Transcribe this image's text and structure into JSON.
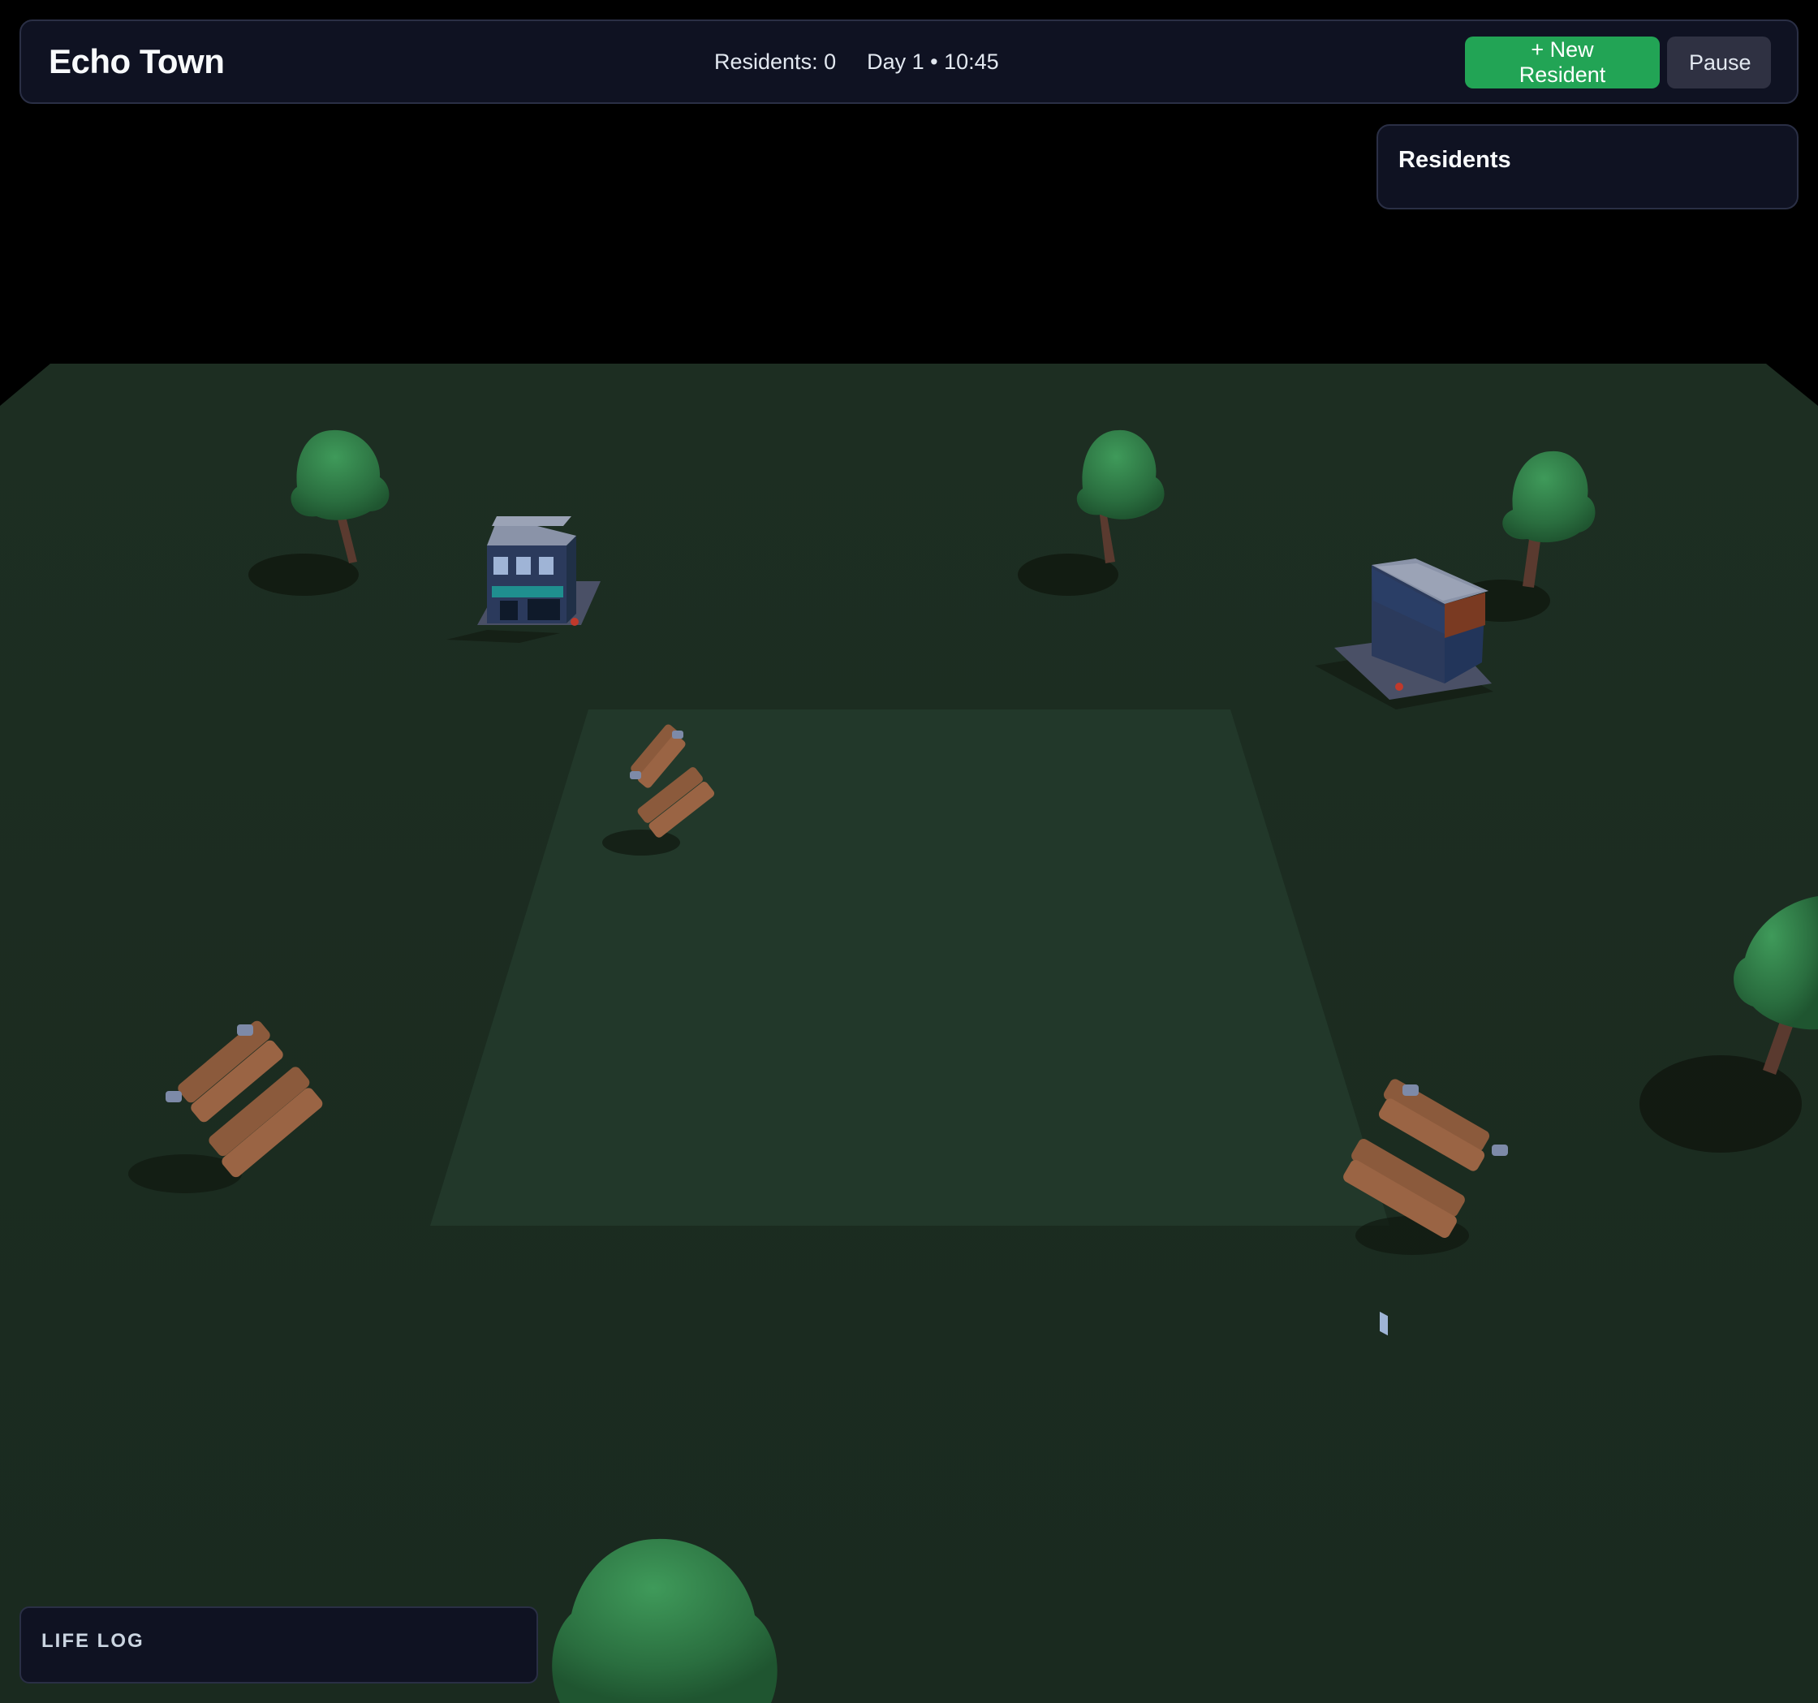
{
  "header": {
    "title": "Echo Town",
    "residents_count": "Residents: 0",
    "clock": "Day 1 • 10:45",
    "new_resident_label": "+ New Resident",
    "pause_label": "Pause"
  },
  "residents_panel": {
    "title": "Residents"
  },
  "life_log": {
    "title": "LIFE LOG"
  },
  "scene": {
    "objects": [
      "tree",
      "tree",
      "tree",
      "tree",
      "tree",
      "shop-building",
      "apartment-building",
      "bench",
      "bench",
      "bench"
    ]
  },
  "colors": {
    "panel_bg": "#0f1222",
    "panel_border": "#2a2f45",
    "accent_green": "#22a455",
    "ground": "#1b2b1f",
    "plaza": "#22382a",
    "tree": "#2f7a45",
    "bench": "#8b5a3c"
  }
}
